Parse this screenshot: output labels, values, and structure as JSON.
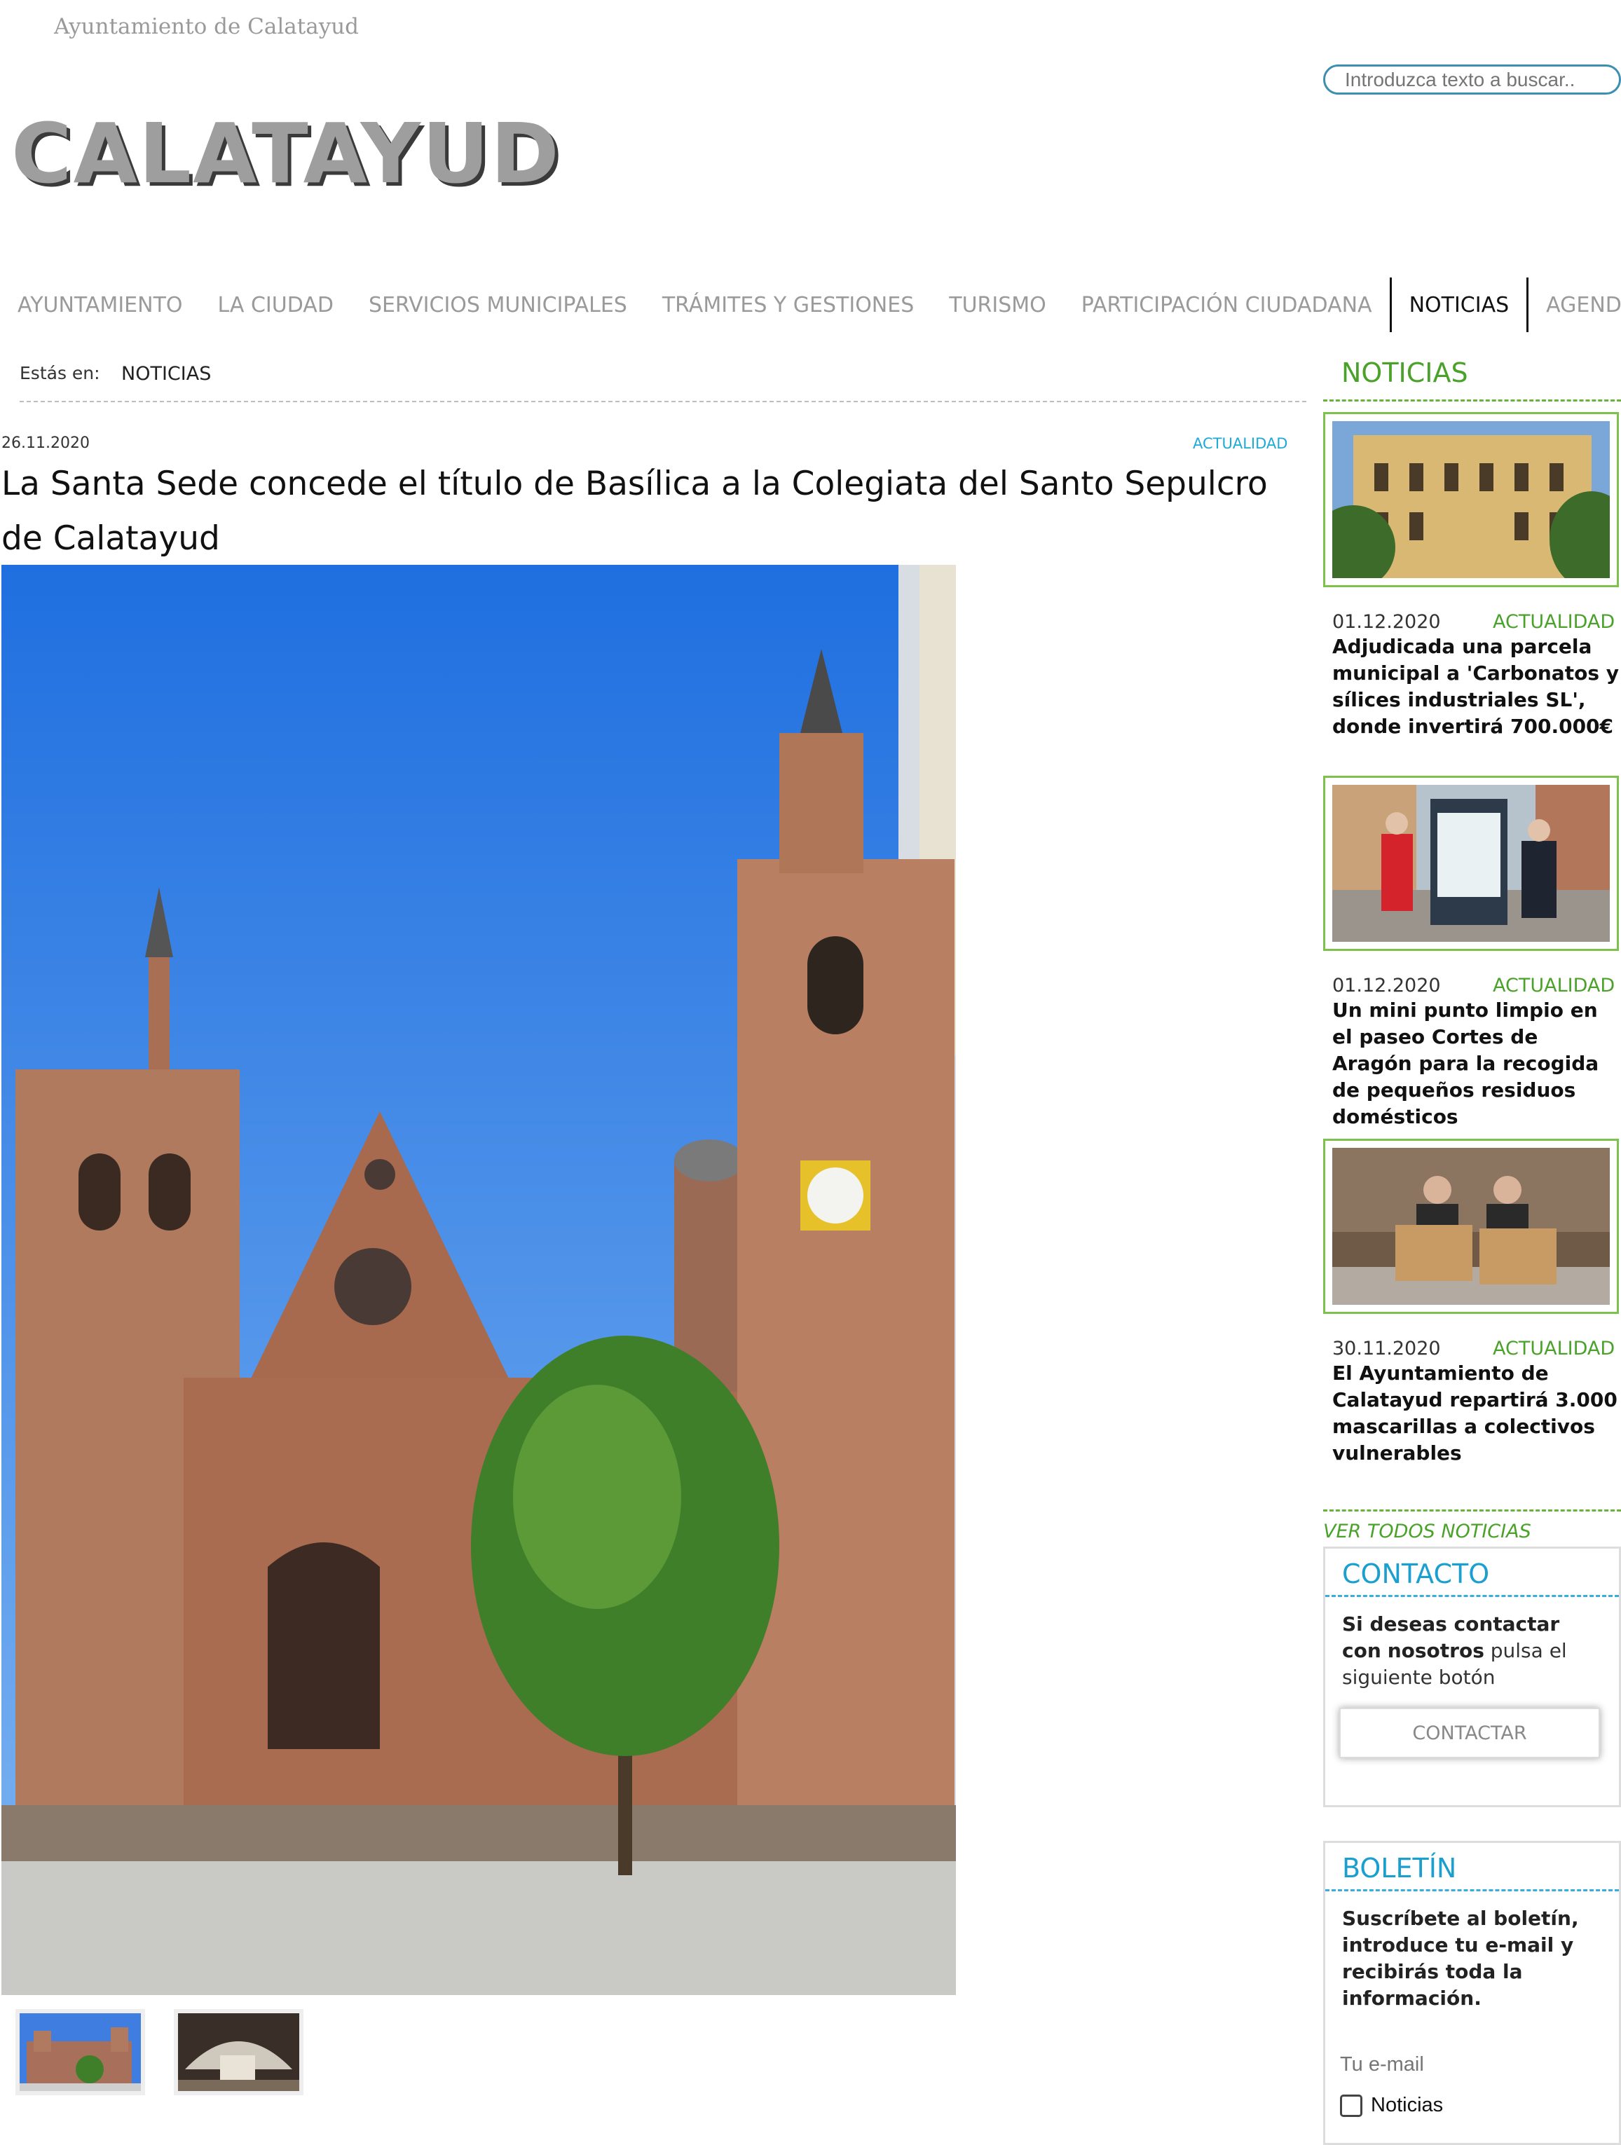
{
  "header": {
    "site_name": "Ayuntamiento de Calatayud",
    "logo": "CALATAYUD",
    "search_placeholder": "Introduzca texto a buscar.."
  },
  "nav": {
    "items": [
      {
        "label": "AYUNTAMIENTO"
      },
      {
        "label": "LA CIUDAD"
      },
      {
        "label": "SERVICIOS MUNICIPALES"
      },
      {
        "label": "TRÁMITES Y GESTIONES"
      },
      {
        "label": "TURISMO"
      },
      {
        "label": "PARTICIPACIÓN CIUDADANA"
      },
      {
        "label": "NOTICIAS",
        "active": true
      },
      {
        "label": "AGENDA"
      }
    ]
  },
  "breadcrumb": {
    "label": "Estás en:",
    "current": "NOTICIAS"
  },
  "article": {
    "date": "26.11.2020",
    "category": "ACTUALIDAD",
    "title": "La Santa Sede concede el título de Basílica a la Colegiata del Santo Sepulcro de Calatayud"
  },
  "sidebar": {
    "title": "NOTICIAS",
    "news": [
      {
        "date": "01.12.2020",
        "category": "ACTUALIDAD",
        "title": "Adjudicada una parcela municipal a 'Carbonatos y sílices industriales SL', donde invertirá 700.000€"
      },
      {
        "date": "01.12.2020",
        "category": "ACTUALIDAD",
        "title": "Un mini punto limpio en el paseo Cortes de Aragón para la recogida de pequeños residuos domésticos"
      },
      {
        "date": "30.11.2020",
        "category": "ACTUALIDAD",
        "title": "El Ayuntamiento de Calatayud repartirá 3.000 mascarillas a colectivos vulnerables"
      }
    ],
    "see_all": "VER TODOS NOTICIAS",
    "contact": {
      "title": "CONTACTO",
      "text_bold_1": "Si deseas contactar con",
      "text_bold_2": "nosotros",
      "text_normal": " pulsa el siguiente botón",
      "button": "CONTACTAR"
    },
    "newsletter": {
      "title": "BOLETÍN",
      "text": "Suscríbete al boletín, introduce tu e-mail y recibirás toda la información.",
      "email_placeholder": "Tu e-mail",
      "checkbox_label": "Noticias"
    }
  }
}
